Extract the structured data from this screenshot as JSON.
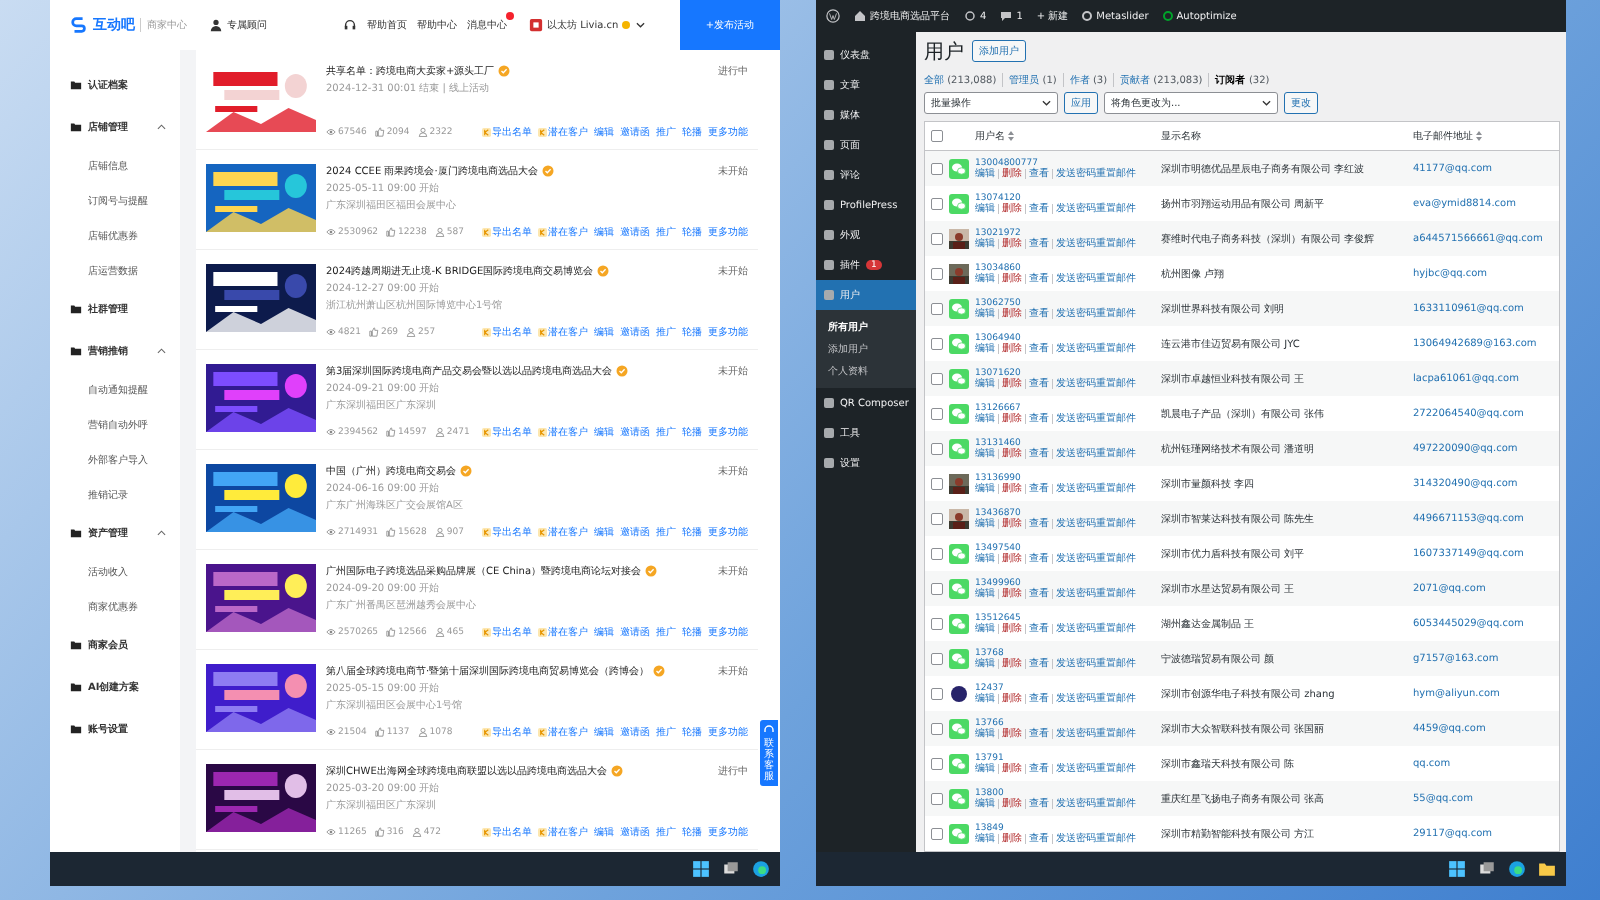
{
  "left_window": {
    "header": {
      "logo": "互动吧",
      "section": "商家中心",
      "advisor": "专属顾问",
      "links": [
        {
          "label": "帮助首页",
          "badge": false
        },
        {
          "label": "帮助中心",
          "badge": false
        },
        {
          "label": "消息中心",
          "badge": true
        }
      ],
      "account": "以太坊 Livia.cn",
      "publish_button": "+发布活动"
    },
    "sidebar": [
      {
        "label": "认证档案"
      },
      {
        "label": "店铺管理",
        "expanded": true,
        "children": [
          "店铺信息",
          "订阅号与提醒",
          "店铺优惠券",
          "店运营数据"
        ]
      },
      {
        "label": "社群管理"
      },
      {
        "label": "营销推销",
        "expanded": true,
        "children": [
          "自动通知提醒",
          "营销自动外呼",
          "外部客户导入",
          "推销记录"
        ]
      },
      {
        "label": "资产管理",
        "expanded": true,
        "children": [
          "活动收入",
          "商家优惠券"
        ]
      },
      {
        "label": "商家会员"
      },
      {
        "label": "AI创建方案"
      },
      {
        "label": "账号设置"
      }
    ],
    "events": [
      {
        "kind": "picture",
        "title": "共享名单：跨境电商大卖家+源头工厂",
        "time": "2024-12-31 00:01 结束 | 线上活动",
        "stats": [
          "67546",
          "2094",
          "2322"
        ],
        "status": "进行中",
        "actions": [
          {
            "label": "导出名单",
            "icon": true
          },
          {
            "label": "潜在客户",
            "icon": true
          },
          {
            "label": "编辑",
            "icon": false
          },
          {
            "label": "邀请函",
            "icon": false
          },
          {
            "label": "推广",
            "icon": false
          },
          {
            "label": "轮播",
            "icon": false
          },
          {
            "label": "更多功能",
            "icon": false
          }
        ]
      },
      {
        "kind": "picture",
        "title": "2024 CCEE 雨果跨境会·厦门跨境电商选品大会",
        "time": "2025-05-11 09:00 开始",
        "place": "广东深圳福田区福田会展中心",
        "stats": [
          "2530962",
          "12238",
          "587"
        ],
        "status": "未开始",
        "actions": [
          {
            "label": "导出名单",
            "icon": true
          },
          {
            "label": "潜在客户",
            "icon": true
          },
          {
            "label": "编辑",
            "icon": false
          },
          {
            "label": "邀请函",
            "icon": false
          },
          {
            "label": "推广",
            "icon": false
          },
          {
            "label": "轮播",
            "icon": false
          },
          {
            "label": "更多功能",
            "icon": false
          }
        ]
      },
      {
        "kind": "picture",
        "title": "2024跨越周期进无止境-K BRIDGE国际跨境电商交易博览会",
        "time": "2024-12-27 09:00 开始",
        "place": "浙江杭州萧山区杭州国际博览中心1号馆",
        "stats": [
          "4821",
          "269",
          "257"
        ],
        "status": "未开始",
        "actions": [
          {
            "label": "导出名单",
            "icon": true
          },
          {
            "label": "潜在客户",
            "icon": true
          },
          {
            "label": "编辑",
            "icon": false
          },
          {
            "label": "邀请函",
            "icon": false
          },
          {
            "label": "推广",
            "icon": false
          },
          {
            "label": "轮播",
            "icon": false
          },
          {
            "label": "更多功能",
            "icon": false
          }
        ]
      },
      {
        "kind": "picture",
        "title": "第3届深圳国际跨境电商产品交易会暨以选以品跨境电商选品大会",
        "time": "2024-09-21 09:00 开始",
        "place": "广东深圳福田区广东深圳",
        "stats": [
          "2394562",
          "14597",
          "2471"
        ],
        "status": "未开始",
        "actions": [
          {
            "label": "导出名单",
            "icon": true
          },
          {
            "label": "潜在客户",
            "icon": true
          },
          {
            "label": "编辑",
            "icon": false
          },
          {
            "label": "邀请函",
            "icon": false
          },
          {
            "label": "推广",
            "icon": false
          },
          {
            "label": "轮播",
            "icon": false
          },
          {
            "label": "更多功能",
            "icon": false
          }
        ]
      },
      {
        "kind": "picture",
        "title": "中国（广州）跨境电商交易会",
        "time": "2024-06-16 09:00 开始",
        "place": "广东广州海珠区广交会展馆A区",
        "stats": [
          "2714931",
          "15628",
          "907"
        ],
        "status": "未开始",
        "actions": [
          {
            "label": "导出名单",
            "icon": true
          },
          {
            "label": "潜在客户",
            "icon": true
          },
          {
            "label": "编辑",
            "icon": false
          },
          {
            "label": "邀请函",
            "icon": false
          },
          {
            "label": "推广",
            "icon": false
          },
          {
            "label": "轮播",
            "icon": false
          },
          {
            "label": "更多功能",
            "icon": false
          }
        ]
      },
      {
        "kind": "picture",
        "title": "广州国际电子跨境选品采购品牌展（CE China）暨跨境电商论坛对接会",
        "time": "2024-09-20 09:00 开始",
        "place": "广东广州番禺区琶洲越秀会展中心",
        "stats": [
          "2570265",
          "12566",
          "465"
        ],
        "status": "未开始",
        "actions": [
          {
            "label": "导出名单",
            "icon": true
          },
          {
            "label": "潜在客户",
            "icon": true
          },
          {
            "label": "编辑",
            "icon": false
          },
          {
            "label": "邀请函",
            "icon": false
          },
          {
            "label": "推广",
            "icon": false
          },
          {
            "label": "轮播",
            "icon": false
          },
          {
            "label": "更多功能",
            "icon": false
          }
        ]
      },
      {
        "kind": "picture",
        "title": "第八届全球跨境电商节·暨第十届深圳国际跨境电商贸易博览会（跨博会）",
        "time": "2025-05-15 09:00 开始",
        "place": "广东深圳福田区会展中心1号馆",
        "stats": [
          "21504",
          "1137",
          "1078"
        ],
        "status": "未开始",
        "actions": [
          {
            "label": "导出名单",
            "icon": true
          },
          {
            "label": "潜在客户",
            "icon": true
          },
          {
            "label": "编辑",
            "icon": false
          },
          {
            "label": "邀请函",
            "icon": false
          },
          {
            "label": "推广",
            "icon": false
          },
          {
            "label": "轮播",
            "icon": false
          },
          {
            "label": "更多功能",
            "icon": false
          }
        ]
      },
      {
        "kind": "picture",
        "title": "深圳CHWE出海网全球跨境电商联盟以选以品跨境电商选品大会",
        "time": "2025-03-20 09:00 开始",
        "place": "广东深圳福田区广东深圳",
        "stats": [
          "11265",
          "316",
          "472"
        ],
        "status": "进行中",
        "actions": [
          {
            "label": "导出名单",
            "icon": true
          },
          {
            "label": "潜在客户",
            "icon": true
          },
          {
            "label": "编辑",
            "icon": false
          },
          {
            "label": "邀请函",
            "icon": false
          },
          {
            "label": "推广",
            "icon": false
          },
          {
            "label": "轮播",
            "icon": false
          },
          {
            "label": "更多功能",
            "icon": false
          }
        ]
      }
    ],
    "service_tab": "联系客服"
  },
  "right_window": {
    "admin_bar": {
      "site": "跨境电商选品平台",
      "updates": "4",
      "comments": "1",
      "new": "+ 新建",
      "items": [
        "Metaslider",
        "Autoptimize"
      ]
    },
    "menu": [
      {
        "label": "仪表盘",
        "selected": false
      },
      {
        "label": "文章",
        "selected": false
      },
      {
        "label": "媒体",
        "selected": false
      },
      {
        "label": "页面",
        "selected": false
      },
      {
        "label": "评论",
        "selected": false
      },
      {
        "label": "ProfilePress",
        "selected": false
      },
      {
        "label": "外观",
        "selected": false
      },
      {
        "label": "插件",
        "selected": false,
        "badge": "1"
      },
      {
        "label": "用户",
        "selected": true,
        "children": [
          {
            "label": "所有用户",
            "selected": true
          },
          {
            "label": "添加用户",
            "selected": false
          },
          {
            "label": "个人资料",
            "selected": false
          }
        ]
      },
      {
        "label": "QR Composer",
        "selected": false
      },
      {
        "label": "工具",
        "selected": false
      },
      {
        "label": "设置",
        "selected": false
      }
    ],
    "page_title": "用户",
    "add_button": "添加用户",
    "filters": [
      {
        "label": "全部",
        "count": "(213,088)",
        "selected": false
      },
      {
        "label": "管理员",
        "count": "(1)",
        "selected": false
      },
      {
        "label": "作者",
        "count": "(3)",
        "selected": false
      },
      {
        "label": "贡献者",
        "count": "(213,083)",
        "selected": false
      },
      {
        "label": "订阅者",
        "count": "(32)",
        "selected": true
      }
    ],
    "bulk_action": {
      "value": "批量操作",
      "button": "应用"
    },
    "role_change": {
      "value": "将角色更改为...",
      "button": "更改"
    },
    "header_checked": false,
    "columns": [
      {
        "label": "用户名",
        "sortable": true
      },
      {
        "label": "显示名称",
        "sortable": false
      },
      {
        "label": "电子邮件地址",
        "sortable": true
      }
    ],
    "rows": [
      {
        "checked": false,
        "kind": "wechat",
        "username": "13004800777",
        "actions": [
          {
            "label": "编辑",
            "danger": false
          },
          {
            "label": "删除",
            "danger": true
          },
          {
            "label": "查看",
            "danger": false
          },
          {
            "label": "发送密码重置邮件",
            "danger": false
          }
        ],
        "display_name": "深圳市明德优品星辰电子商务有限公司 李红波",
        "email": "41177@qq.com"
      },
      {
        "checked": false,
        "kind": "wechat",
        "username": "13074120",
        "actions": [
          {
            "label": "编辑",
            "danger": false
          },
          {
            "label": "删除",
            "danger": true
          },
          {
            "label": "查看",
            "danger": false
          },
          {
            "label": "发送密码重置邮件",
            "danger": false
          }
        ],
        "display_name": "扬州市羽翔运动用品有限公司 周新平",
        "email": "eva@ymid8814.com"
      },
      {
        "checked": false,
        "username": "13021972",
        "actions": [
          {
            "label": "编辑",
            "danger": false
          },
          {
            "label": "删除",
            "danger": true
          },
          {
            "label": "查看",
            "danger": false
          },
          {
            "label": "发送密码重置邮件",
            "danger": false
          }
        ],
        "display_name": "赛维时代电子商务科技（深圳）有限公司 李俊辉",
        "email": "a644571566661@qq.com"
      },
      {
        "checked": false,
        "username": "13034860",
        "actions": [
          {
            "label": "编辑",
            "danger": false
          },
          {
            "label": "删除",
            "danger": true
          },
          {
            "label": "查看",
            "danger": false
          },
          {
            "label": "发送密码重置邮件",
            "danger": false
          }
        ],
        "display_name": "杭州图像 卢翔",
        "email": "hyjbc@qq.com"
      },
      {
        "checked": false,
        "kind": "wechat",
        "username": "13062750",
        "actions": [
          {
            "label": "编辑",
            "danger": false
          },
          {
            "label": "删除",
            "danger": true
          },
          {
            "label": "查看",
            "danger": false
          },
          {
            "label": "发送密码重置邮件",
            "danger": false
          }
        ],
        "display_name": "深圳世界科技有限公司 刘明",
        "email": "1633110961@qq.com"
      },
      {
        "checked": false,
        "kind": "wechat",
        "username": "13064940",
        "actions": [
          {
            "label": "编辑",
            "danger": false
          },
          {
            "label": "删除",
            "danger": true
          },
          {
            "label": "查看",
            "danger": false
          },
          {
            "label": "发送密码重置邮件",
            "danger": false
          }
        ],
        "display_name": "连云港市佳迈贸易有限公司 JYC",
        "email": "13064942689@163.com"
      },
      {
        "checked": false,
        "kind": "wechat",
        "username": "13071620",
        "actions": [
          {
            "label": "编辑",
            "danger": false
          },
          {
            "label": "删除",
            "danger": true
          },
          {
            "label": "查看",
            "danger": false
          },
          {
            "label": "发送密码重置邮件",
            "danger": false
          }
        ],
        "display_name": "深圳市卓越恒业科技有限公司 王",
        "email": "lacpa61061@qq.com"
      },
      {
        "checked": false,
        "kind": "wechat",
        "username": "13126667",
        "actions": [
          {
            "label": "编辑",
            "danger": false
          },
          {
            "label": "删除",
            "danger": true
          },
          {
            "label": "查看",
            "danger": false
          },
          {
            "label": "发送密码重置邮件",
            "danger": false
          }
        ],
        "display_name": "凯晨电子产品（深圳）有限公司 张伟",
        "email": "2722064540@qq.com"
      },
      {
        "checked": false,
        "kind": "wechat",
        "username": "13131460",
        "actions": [
          {
            "label": "编辑",
            "danger": false
          },
          {
            "label": "删除",
            "danger": true
          },
          {
            "label": "查看",
            "danger": false
          },
          {
            "label": "发送密码重置邮件",
            "danger": false
          }
        ],
        "display_name": "杭州钰瑾网络技术有限公司 潘道明",
        "email": "497220090@qq.com"
      },
      {
        "checked": false,
        "username": "13136990",
        "actions": [
          {
            "label": "编辑",
            "danger": false
          },
          {
            "label": "删除",
            "danger": true
          },
          {
            "label": "查看",
            "danger": false
          },
          {
            "label": "发送密码重置邮件",
            "danger": false
          }
        ],
        "display_name": "深圳市量颜科技 李四",
        "email": "314320490@qq.com"
      },
      {
        "checked": false,
        "username": "13436870",
        "actions": [
          {
            "label": "编辑",
            "danger": false
          },
          {
            "label": "删除",
            "danger": true
          },
          {
            "label": "查看",
            "danger": false
          },
          {
            "label": "发送密码重置邮件",
            "danger": false
          }
        ],
        "display_name": "深圳市智莱达科技有限公司 陈先生",
        "email": "4496671153@qq.com"
      },
      {
        "checked": false,
        "kind": "wechat",
        "username": "13497540",
        "actions": [
          {
            "label": "编辑",
            "danger": false
          },
          {
            "label": "删除",
            "danger": true
          },
          {
            "label": "查看",
            "danger": false
          },
          {
            "label": "发送密码重置邮件",
            "danger": false
          }
        ],
        "display_name": "深圳市优力盾科技有限公司 刘平",
        "email": "1607337149@qq.com"
      },
      {
        "checked": false,
        "kind": "wechat",
        "username": "13499960",
        "actions": [
          {
            "label": "编辑",
            "danger": false
          },
          {
            "label": "删除",
            "danger": true
          },
          {
            "label": "查看",
            "danger": false
          },
          {
            "label": "发送密码重置邮件",
            "danger": false
          }
        ],
        "display_name": "深圳市水星达贸易有限公司 王",
        "email": "2071@qq.com"
      },
      {
        "checked": false,
        "kind": "wechat",
        "username": "13512645",
        "actions": [
          {
            "label": "编辑",
            "danger": false
          },
          {
            "label": "删除",
            "danger": true
          },
          {
            "label": "查看",
            "danger": false
          },
          {
            "label": "发送密码重置邮件",
            "danger": false
          }
        ],
        "display_name": "湖州鑫达金属制品 王",
        "email": "6053445029@qq.com"
      },
      {
        "checked": false,
        "kind": "wechat",
        "username": "13768",
        "actions": [
          {
            "label": "编辑",
            "danger": false
          },
          {
            "label": "删除",
            "danger": true
          },
          {
            "label": "查看",
            "danger": false
          },
          {
            "label": "发送密码重置邮件",
            "danger": false
          }
        ],
        "display_name": "宁波德瑞贸易有限公司 颜",
        "email": "g7157@163.com"
      },
      {
        "checked": false,
        "kind": "blob",
        "username": "12437",
        "actions": [
          {
            "label": "编辑",
            "danger": false
          },
          {
            "label": "删除",
            "danger": true
          },
          {
            "label": "查看",
            "danger": false
          },
          {
            "label": "发送密码重置邮件",
            "danger": false
          }
        ],
        "display_name": "深圳市创源华电子科技有限公司 zhang",
        "email": "hym@aliyun.com"
      },
      {
        "checked": false,
        "kind": "wechat",
        "username": "13766",
        "actions": [
          {
            "label": "编辑",
            "danger": false
          },
          {
            "label": "删除",
            "danger": true
          },
          {
            "label": "查看",
            "danger": false
          },
          {
            "label": "发送密码重置邮件",
            "danger": false
          }
        ],
        "display_name": "深圳市大众智联科技有限公司 张国丽",
        "email": "4459@qq.com"
      },
      {
        "checked": false,
        "kind": "wechat",
        "username": "13791",
        "actions": [
          {
            "label": "编辑",
            "danger": false
          },
          {
            "label": "删除",
            "danger": true
          },
          {
            "label": "查看",
            "danger": false
          },
          {
            "label": "发送密码重置邮件",
            "danger": false
          }
        ],
        "display_name": "深圳市鑫瑞天科技有限公司 陈",
        "email": "qq.com"
      },
      {
        "checked": false,
        "kind": "wechat",
        "username": "13800",
        "actions": [
          {
            "label": "编辑",
            "danger": false
          },
          {
            "label": "删除",
            "danger": true
          },
          {
            "label": "查看",
            "danger": false
          },
          {
            "label": "发送密码重置邮件",
            "danger": false
          }
        ],
        "display_name": "重庆红星飞扬电子商务有限公司 张高",
        "email": "55@qq.com"
      },
      {
        "checked": false,
        "kind": "wechat",
        "username": "13849",
        "actions": [
          {
            "label": "编辑",
            "danger": false
          },
          {
            "label": "删除",
            "danger": true
          },
          {
            "label": "查看",
            "danger": false
          },
          {
            "label": "发送密码重置邮件",
            "danger": false
          }
        ],
        "display_name": "深圳市精勤智能科技有限公司 方江",
        "email": "29117@qq.com"
      }
    ]
  }
}
